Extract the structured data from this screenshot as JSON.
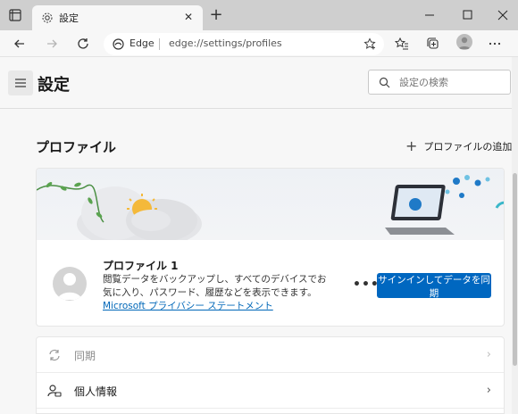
{
  "browser": {
    "tab_title": "設定",
    "address_site": "Edge",
    "address_url": "edge://settings/profiles"
  },
  "header": {
    "title": "設定",
    "search_placeholder": "設定の検索"
  },
  "profiles": {
    "section_title": "プロファイル",
    "add_profile": "プロファイルの追加",
    "profile_name": "プロファイル 1",
    "description": "閲覧データをバックアップし、すべてのデバイスでお気に入り、パスワード、履歴などを表示できます。",
    "privacy_link": "Microsoft プライバシー ステートメント",
    "more_label": "•••",
    "signin_button": "サインインしてデータを同期"
  },
  "settings_list": [
    {
      "label": "同期",
      "icon": "sync-icon",
      "enabled": false
    },
    {
      "label": "個人情報",
      "icon": "personal-info-icon",
      "enabled": true
    }
  ],
  "colors": {
    "accent": "#0067c0",
    "link": "#0067b8"
  }
}
